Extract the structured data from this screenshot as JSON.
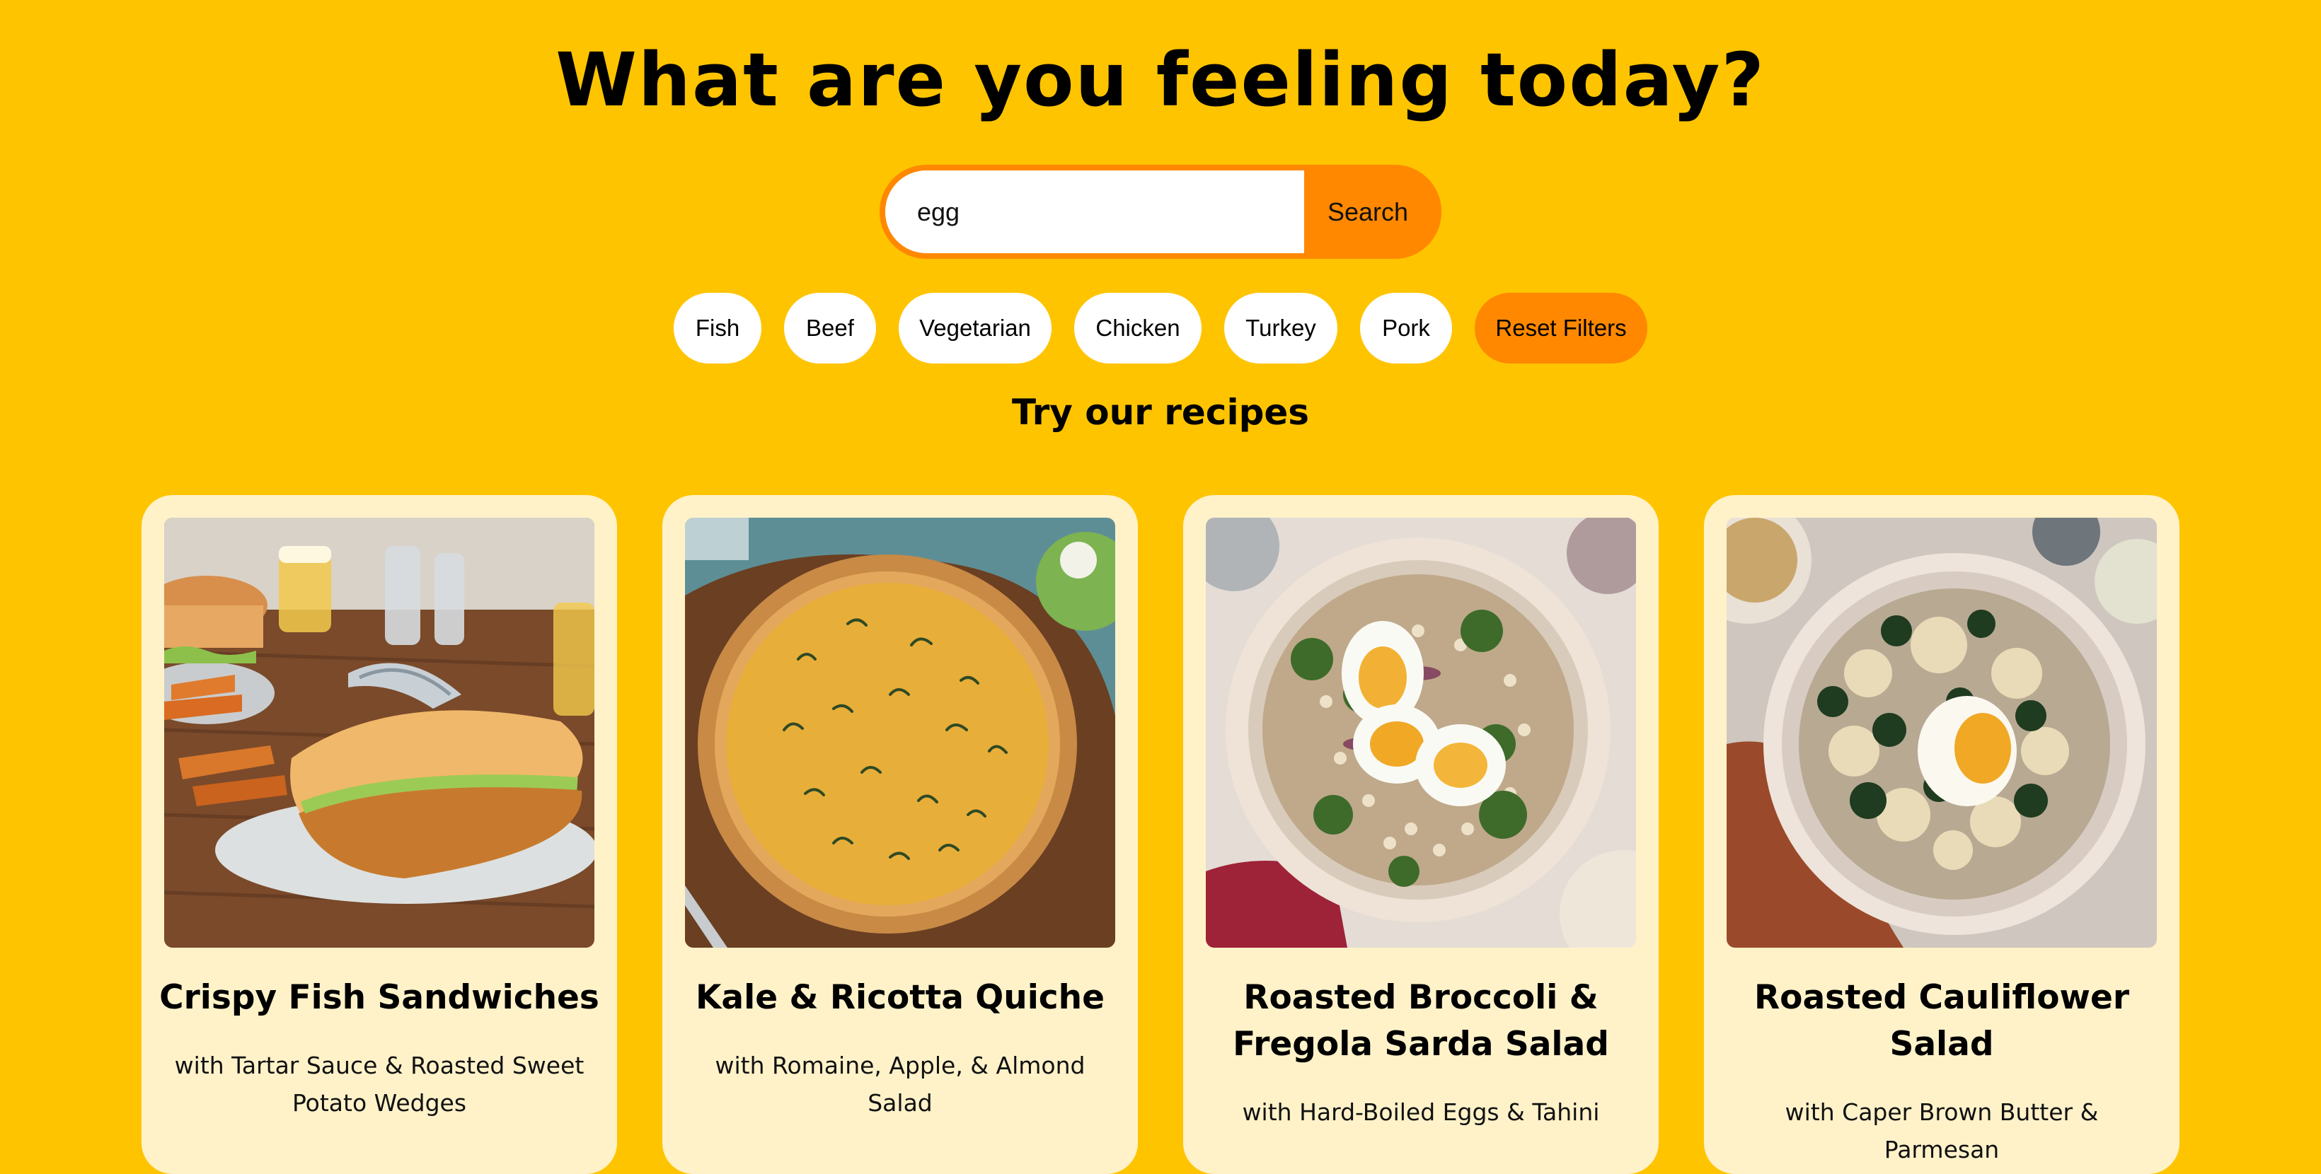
{
  "header": {
    "title": "What are you feeling today?"
  },
  "search": {
    "value": "egg",
    "button_label": "Search"
  },
  "filters": {
    "items": [
      {
        "label": "Fish"
      },
      {
        "label": "Beef"
      },
      {
        "label": "Vegetarian"
      },
      {
        "label": "Chicken"
      },
      {
        "label": "Turkey"
      },
      {
        "label": "Pork"
      }
    ],
    "reset_label": "Reset Filters"
  },
  "recipes": {
    "heading": "Try our recipes",
    "cards": [
      {
        "title": "Crispy Fish Sandwiches",
        "subtitle": "with Tartar Sauce & Roasted Sweet Potato Wedges"
      },
      {
        "title": "Kale & Ricotta Quiche",
        "subtitle": "with Romaine, Apple, & Almond Salad"
      },
      {
        "title": "Roasted Broccoli & Fregola Sarda Salad",
        "subtitle": "with Hard-Boiled Eggs & Tahini"
      },
      {
        "title": "Roasted Cauliflower Salad",
        "subtitle": "with Caper Brown Butter & Parmesan"
      }
    ]
  },
  "colors": {
    "background": "#FFC400",
    "accent": "#FF8800",
    "card": "#FFF2C9",
    "pill": "#FFFFFF"
  }
}
